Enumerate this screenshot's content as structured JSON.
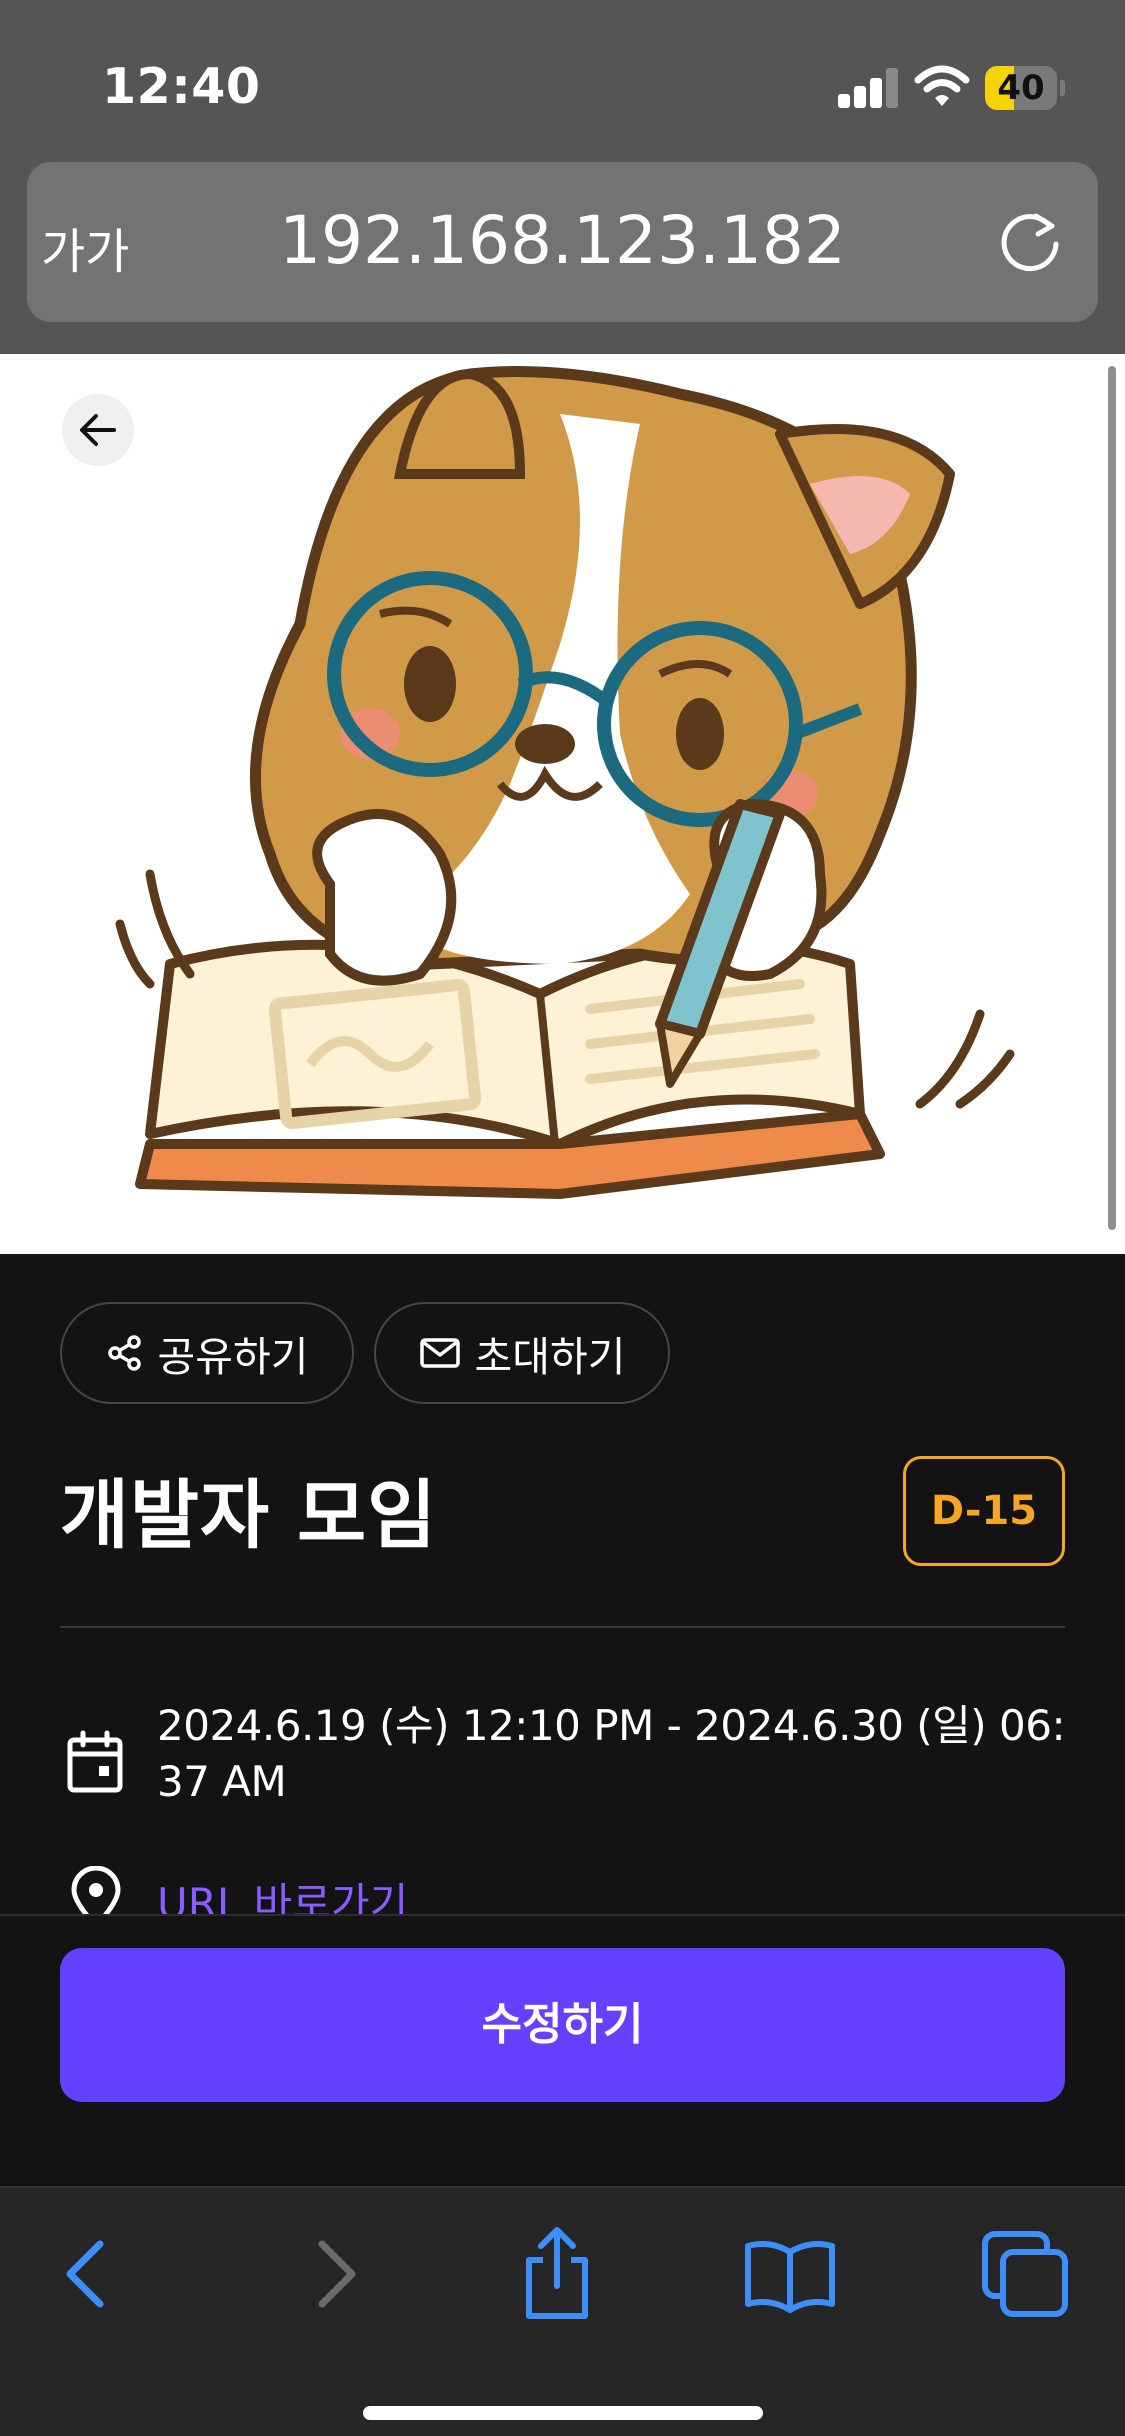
{
  "status_bar": {
    "time": "12:40",
    "battery_level": "40",
    "battery_fraction": 0.4
  },
  "browser": {
    "text_size_button": "가가",
    "url": "192.168.123.182"
  },
  "event": {
    "actions": {
      "share_label": "공유하기",
      "invite_label": "초대하기"
    },
    "title": "개발자 모임",
    "dday": "D-15",
    "datetime": "2024.6.19 (수) 12:10 PM - 2024.6.30 (일) 06:37 AM",
    "location_link": "URL 바로가기",
    "edit_button": "수정하기"
  },
  "colors": {
    "accent": "#6440ff",
    "dday": "#f5a623",
    "link": "#8a5cff",
    "browser_blue": "#3d8ef8"
  },
  "toolbar": {
    "icons": [
      "back-icon",
      "forward-icon",
      "share-icon",
      "bookmarks-icon",
      "tabs-icon"
    ]
  }
}
